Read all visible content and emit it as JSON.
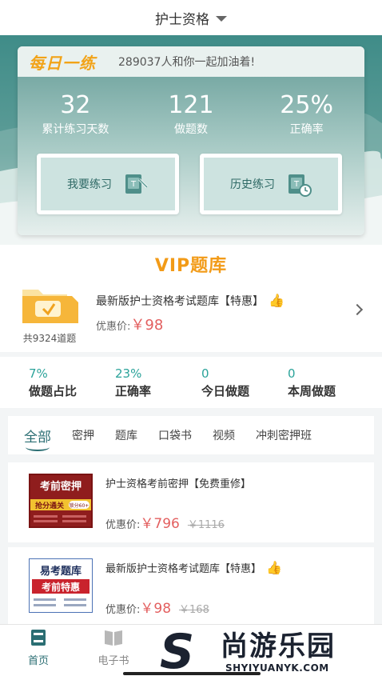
{
  "header": {
    "title": "护士资格"
  },
  "daily": {
    "brand": "每日一练",
    "motto": "289037人和你一起加油着!",
    "stats": [
      {
        "value": "32",
        "label": "累计练习天数"
      },
      {
        "value": "121",
        "label": "做题数"
      },
      {
        "value": "25%",
        "label": "正确率"
      }
    ],
    "practice_button": "我要练习",
    "history_button": "历史练习"
  },
  "vip": {
    "title": "VIP题库",
    "count": "共9324道题",
    "name": "最新版护士资格考试题库【特惠】",
    "price_label": "优惠价:",
    "price": "￥98"
  },
  "progress": [
    {
      "value": "7%",
      "label": "做题占比"
    },
    {
      "value": "23%",
      "label": "正确率"
    },
    {
      "value": "0",
      "label": "今日做题"
    },
    {
      "value": "0",
      "label": "本周做题"
    }
  ],
  "tabs": [
    "全部",
    "密押",
    "题库",
    "口袋书",
    "视频",
    "冲刺密押班"
  ],
  "products": [
    {
      "name": "护士资格考前密押【免费重修】",
      "price_label": "优惠价:",
      "price": "￥796",
      "old_price": "￥1116",
      "cover_line1": "考前密押",
      "cover_line2": "抢分通关",
      "cover_badge": "锁分60+"
    },
    {
      "name": "最新版护士资格考试题库【特惠】",
      "price_label": "优惠价:",
      "price": "￥98",
      "old_price": "￥168",
      "cover_line1": "易考题库",
      "cover_line2": "考前特惠"
    }
  ],
  "nav": {
    "home": "首页",
    "ebook": "电子书"
  },
  "watermark": {
    "letter": "S",
    "cn": "尚游乐园",
    "en": "SHYIYUANYK.COM"
  },
  "colors": {
    "teal": "#2b6e73",
    "orange": "#f29b18",
    "price_red": "#e35f5f",
    "accent_green": "#2ba39a"
  }
}
